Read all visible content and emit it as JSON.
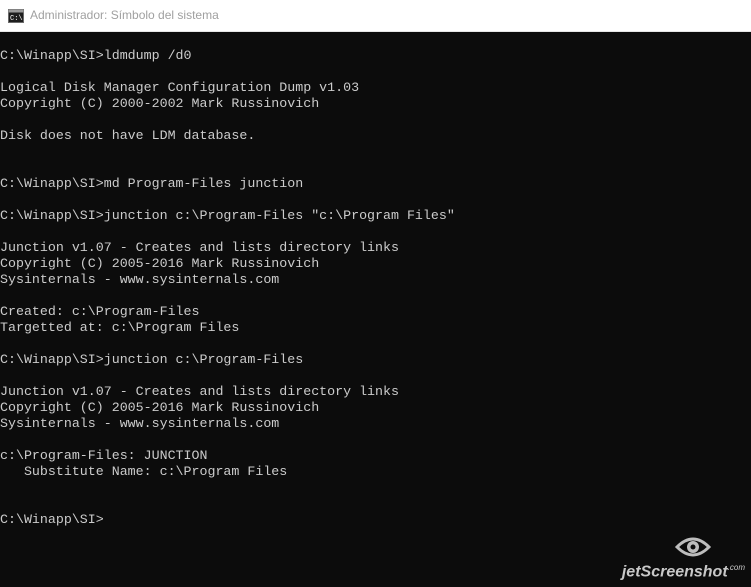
{
  "window": {
    "title": "Administrador: Símbolo del sistema",
    "icon": "cmd-icon"
  },
  "console": {
    "lines": [
      "C:\\Winapp\\SI>ldmdump /d0",
      "",
      "Logical Disk Manager Configuration Dump v1.03",
      "Copyright (C) 2000-2002 Mark Russinovich",
      "",
      "Disk does not have LDM database.",
      "",
      "",
      "C:\\Winapp\\SI>md Program-Files junction",
      "",
      "C:\\Winapp\\SI>junction c:\\Program-Files \"c:\\Program Files\"",
      "",
      "Junction v1.07 - Creates and lists directory links",
      "Copyright (C) 2005-2016 Mark Russinovich",
      "Sysinternals - www.sysinternals.com",
      "",
      "Created: c:\\Program-Files",
      "Targetted at: c:\\Program Files",
      "",
      "C:\\Winapp\\SI>junction c:\\Program-Files",
      "",
      "Junction v1.07 - Creates and lists directory links",
      "Copyright (C) 2005-2016 Mark Russinovich",
      "Sysinternals - www.sysinternals.com",
      "",
      "c:\\Program-Files: JUNCTION",
      "   Substitute Name: c:\\Program Files",
      "",
      "",
      "C:\\Winapp\\SI>"
    ]
  },
  "watermark": {
    "text": "jetScreenshot",
    "suffix": ".com",
    "icon": "eye-logo-icon"
  },
  "colors": {
    "background": "#0c0c0c",
    "text": "#cccccc",
    "titlebar": "#ffffff",
    "title_text": "#a0a0a0"
  }
}
